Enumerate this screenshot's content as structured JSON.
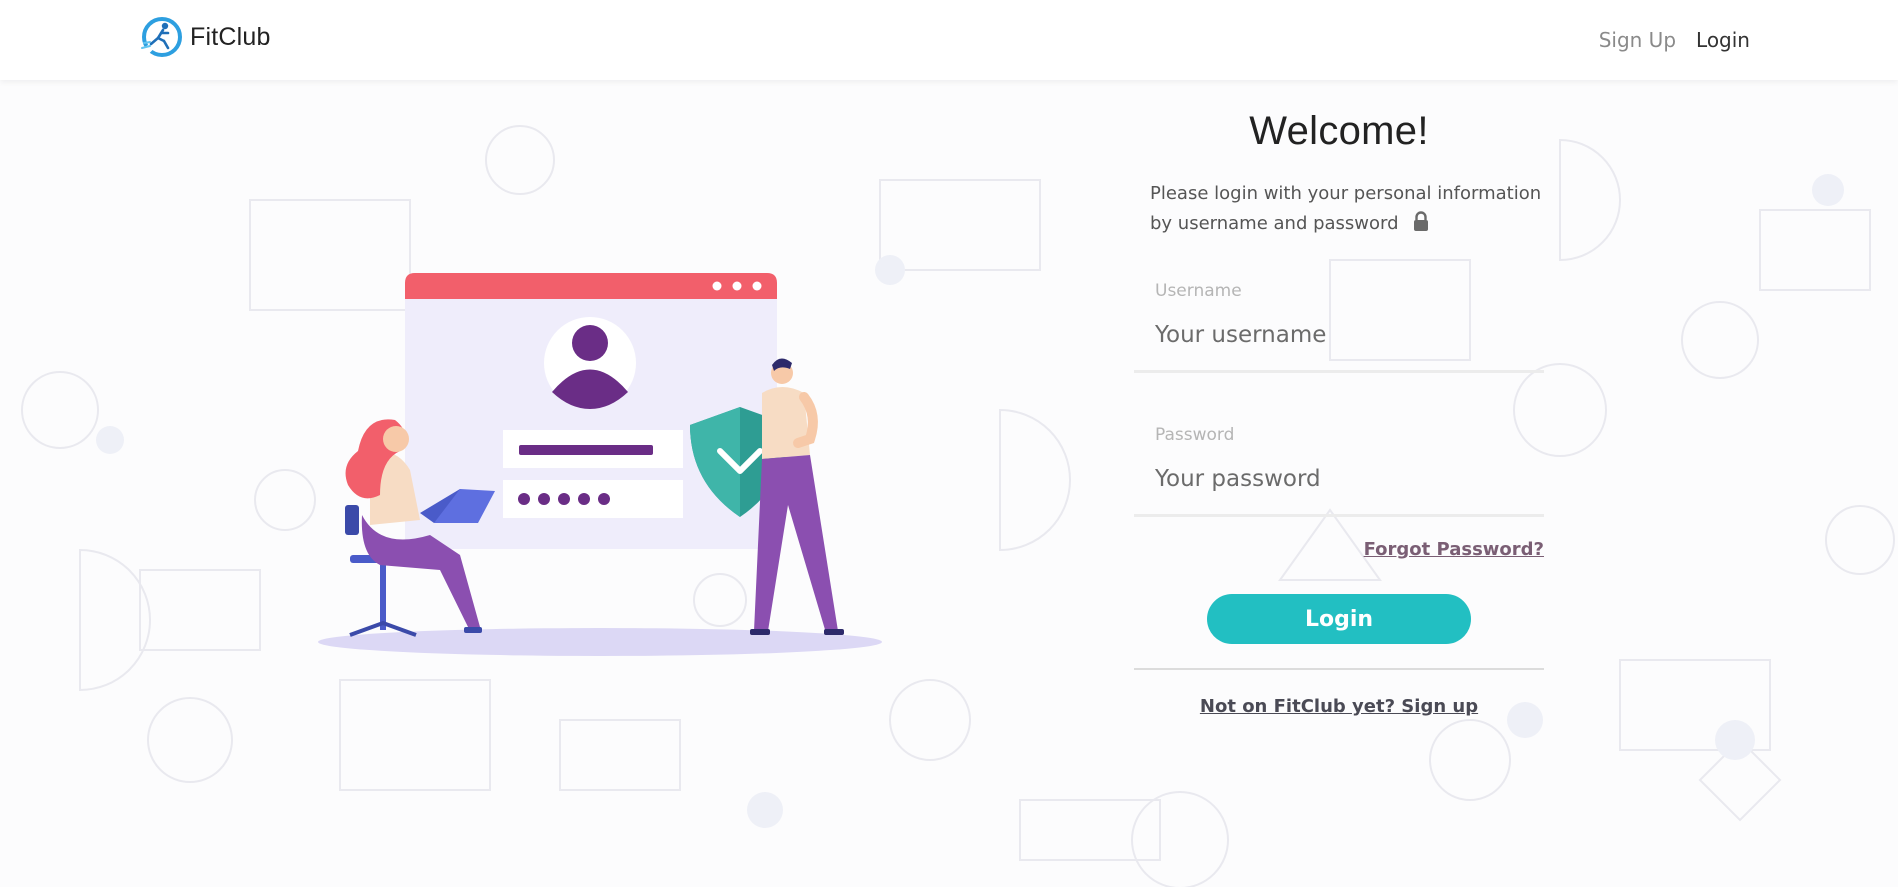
{
  "navbar": {
    "brand_name": "FitClub",
    "logo_icon": "fitclub-runner-logo-icon",
    "links": [
      {
        "label": "Sign Up"
      },
      {
        "label": "Login"
      }
    ]
  },
  "login": {
    "title": "Welcome!",
    "intro_line1": "Please login with your personal information",
    "intro_line2": "by username and password",
    "intro_icon": "lock-icon",
    "username_label": "Username",
    "username_placeholder": "Your username",
    "password_label": "Password",
    "password_placeholder": "Your password",
    "forgot_label": "Forgot Password?",
    "submit_label": "Login",
    "signup_prompt": "Not on FitClub yet? Sign up"
  },
  "colors": {
    "accent": "#22bfc2",
    "browser_bar": "#f25f6b",
    "avatar": "#6a2d86",
    "shield": "#3fb5a9",
    "forgot_link": "#7a5e74"
  }
}
